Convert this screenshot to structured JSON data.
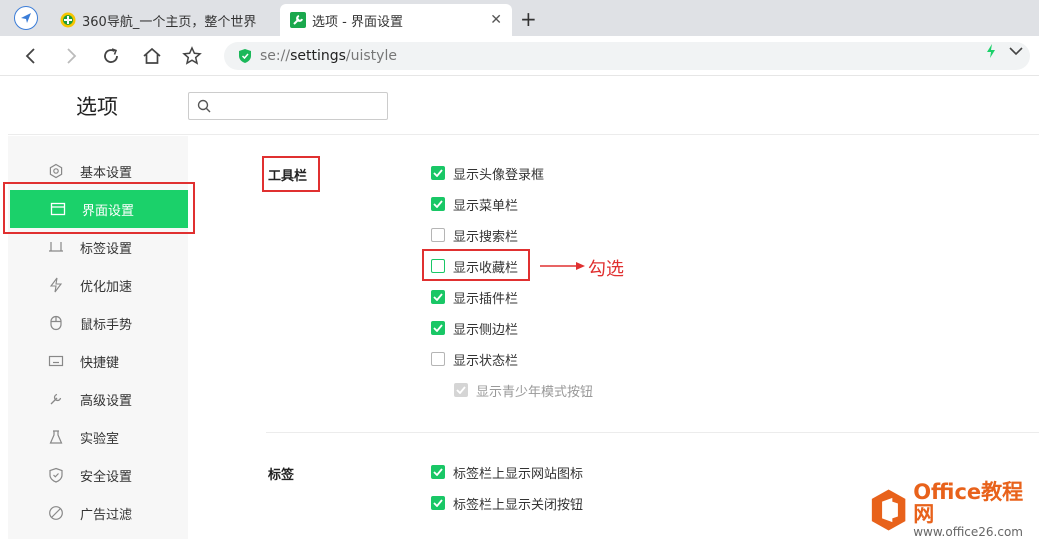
{
  "tabs": [
    {
      "title": "360导航_一个主页，整个世界",
      "icon": "globe-plus-icon",
      "active": false
    },
    {
      "title": "选项 - 界面设置",
      "icon": "wrench-icon",
      "active": true
    }
  ],
  "tab_close": "✕",
  "new_tab": "+",
  "address": {
    "scheme": "se://",
    "host": "settings",
    "path": "/uistyle"
  },
  "page": {
    "title": "选项",
    "search_placeholder": ""
  },
  "sidebar": {
    "items": [
      {
        "label": "基本设置",
        "icon": "gear-icon",
        "active": false
      },
      {
        "label": "界面设置",
        "icon": "window-icon",
        "active": true
      },
      {
        "label": "标签设置",
        "icon": "tab-icon",
        "active": false
      },
      {
        "label": "优化加速",
        "icon": "lightning-icon",
        "active": false
      },
      {
        "label": "鼠标手势",
        "icon": "mouse-icon",
        "active": false
      },
      {
        "label": "快捷键",
        "icon": "keyboard-icon",
        "active": false
      },
      {
        "label": "高级设置",
        "icon": "wrench-icon",
        "active": false
      },
      {
        "label": "实验室",
        "icon": "flask-icon",
        "active": false
      },
      {
        "label": "安全设置",
        "icon": "shield-icon",
        "active": false
      },
      {
        "label": "广告过滤",
        "icon": "block-icon",
        "active": false
      }
    ]
  },
  "toolbar_section": {
    "label": "工具栏",
    "options": [
      {
        "label": "显示头像登录框",
        "checked": true
      },
      {
        "label": "显示菜单栏",
        "checked": true
      },
      {
        "label": "显示搜索栏",
        "checked": false
      },
      {
        "label": "显示收藏栏",
        "checked": false
      },
      {
        "label": "显示插件栏",
        "checked": true
      },
      {
        "label": "显示侧边栏",
        "checked": true
      },
      {
        "label": "显示状态栏",
        "checked": false
      },
      {
        "label": "显示青少年模式按钮",
        "checked": true,
        "disabled": true
      }
    ]
  },
  "annotation": "勾选",
  "tab_section": {
    "label": "标签",
    "options": [
      {
        "label": "标签栏上显示网站图标",
        "checked": true
      },
      {
        "label": "标签栏上显示关闭按钮",
        "checked": true
      }
    ]
  },
  "watermark": {
    "title": "Office教程网",
    "url": "www.office26.com"
  },
  "colors": {
    "accent": "#1bd16a",
    "check": "#19c766",
    "highlight": "#e03030",
    "watermark": "#e8621b"
  }
}
